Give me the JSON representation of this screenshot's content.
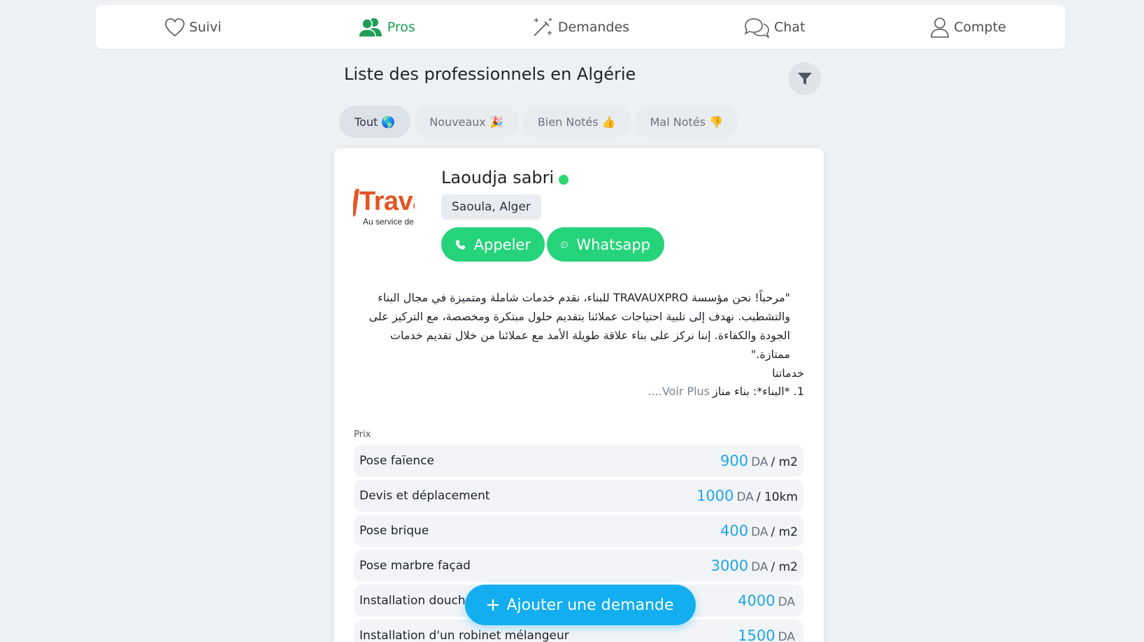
{
  "nav": {
    "items": [
      {
        "label": "Suivi",
        "icon": "heart-icon"
      },
      {
        "label": "Pros",
        "icon": "users-icon"
      },
      {
        "label": "Demandes",
        "icon": "magic-wand-icon"
      },
      {
        "label": "Chat",
        "icon": "chat-bubbles-icon"
      },
      {
        "label": "Compte",
        "icon": "user-icon"
      }
    ],
    "active": "Pros",
    "active_color": "#1e9f55"
  },
  "page": {
    "title": "Liste des professionnels en Algérie"
  },
  "tabs": [
    {
      "label": "Tout 🌎",
      "active": true
    },
    {
      "label": "Nouveaux 🎉",
      "active": false
    },
    {
      "label": "Bien Notés 👍",
      "active": false
    },
    {
      "label": "Mal Notés 👎",
      "active": false
    }
  ],
  "card": {
    "logo": {
      "text": "Travaux",
      "subtitle": "Au service de"
    },
    "name": "Laoudja sabri",
    "online_color": "#2ed573",
    "location": "Saoula, Alger",
    "call_label": "Appeler",
    "whatsapp_label": "Whatsapp",
    "description": "\"مرحباً! نحن مؤسسة TRAVAUXPRO للبناء، نقدم خدمات شاملة ومتميزة في مجال البناء والتشطيب. نهدف إلى تلبية احتياجات عملائنا بتقديم حلول مبتكرة ومخصصة، مع التركيز على الجودة والكفاءة. إننا نركز على بناء علاقة طويلة الأمد مع عملائنا من خلال تقديم خدمات ممتازة.\"",
    "services_heading": "خدماتنا",
    "services_first": "1. *البناء*: بناء مناز",
    "voir_plus": "Voir Plus....",
    "prix_label": "Prix",
    "prices": [
      {
        "name": "Pose faïence",
        "amount": "900",
        "currency": "DA",
        "unit": "/ m2"
      },
      {
        "name": "Devis et déplacement",
        "amount": "1000",
        "currency": "DA",
        "unit": "/ 10km"
      },
      {
        "name": "Pose brique",
        "amount": "400",
        "currency": "DA",
        "unit": "/ m2"
      },
      {
        "name": "Pose marbre façad",
        "amount": "3000",
        "currency": "DA",
        "unit": "/ m2"
      },
      {
        "name": "Installation douche c",
        "amount": "4000",
        "currency": "DA",
        "unit": ""
      },
      {
        "name": "Installation d'un robinet mélangeur",
        "amount": "1500",
        "currency": "DA",
        "unit": ""
      }
    ]
  },
  "fab": {
    "label": "Ajouter une demande"
  },
  "colors": {
    "accent_green": "#25d37b",
    "accent_blue": "#12aef0",
    "price_blue": "#1ea6e8",
    "brand_orange": "#e45521"
  }
}
